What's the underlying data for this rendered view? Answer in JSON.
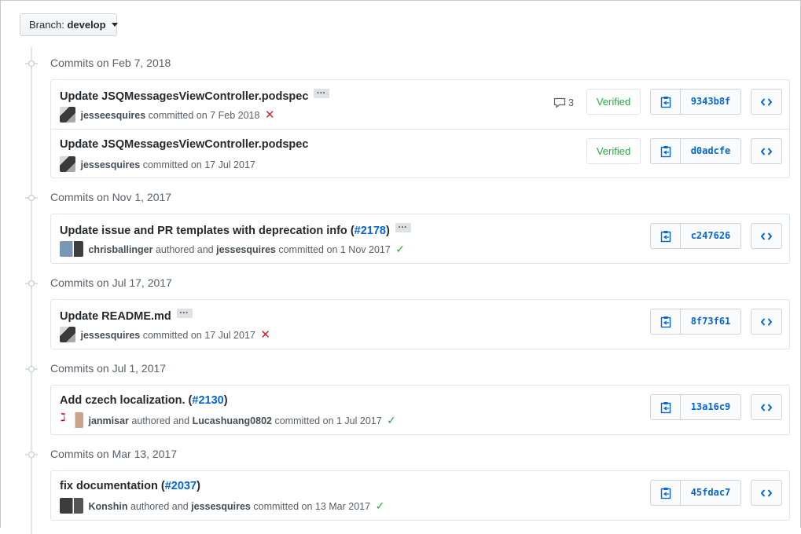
{
  "branch": {
    "label": "Branch:",
    "name": "develop"
  },
  "groups": [
    {
      "title": "Commits on Feb 7, 2018",
      "commits": [
        {
          "message": "Update JSQMessagesViewController.podspec",
          "has_ellipsis": true,
          "author": "jesseesquires",
          "meta_text": "committed on 7 Feb 2018",
          "status": "fail",
          "comments": "3",
          "verified": "Verified",
          "sha": "9343b8f"
        },
        {
          "message": "Update JSQMessagesViewController.podspec",
          "has_ellipsis": false,
          "author": "jessesquires",
          "meta_text": "committed on 17 Jul 2017",
          "status": "",
          "comments": "",
          "verified": "Verified",
          "sha": "d0adcfe"
        }
      ]
    },
    {
      "title": "Commits on Nov 1, 2017",
      "commits": [
        {
          "message": "Update issue and PR templates with deprecation info (",
          "pr": "#2178",
          "message_end": ")",
          "has_ellipsis": true,
          "author": "chrisballinger",
          "authored": "authored and",
          "committer": "jessesquires",
          "meta_text": "committed on 1 Nov 2017",
          "status": "ok",
          "sha": "c247626"
        }
      ]
    },
    {
      "title": "Commits on Jul 17, 2017",
      "commits": [
        {
          "message": "Update README.md",
          "has_ellipsis": true,
          "author": "jessesquires",
          "meta_text": "committed on 17 Jul 2017",
          "status": "fail",
          "sha": "8f73f61"
        }
      ]
    },
    {
      "title": "Commits on Jul 1, 2017",
      "commits": [
        {
          "message": "Add czech localization. (",
          "pr": "#2130",
          "message_end": ")",
          "has_ellipsis": false,
          "author": "janmisar",
          "authored": "authored and",
          "committer": "Lucashuang0802",
          "meta_text": "committed on 1 Jul 2017",
          "status": "ok",
          "sha": "13a16c9"
        }
      ]
    },
    {
      "title": "Commits on Mar 13, 2017",
      "commits": [
        {
          "message": "fix documentation (",
          "pr": "#2037",
          "message_end": ")",
          "has_ellipsis": false,
          "author": "Konshin",
          "authored": "authored and",
          "committer": "jessesquires",
          "meta_text": "committed on 13 Mar 2017",
          "status": "ok",
          "sha": "45fdac7"
        }
      ]
    }
  ],
  "colors": {
    "link": "#0366d6",
    "success": "#28a745",
    "fail": "#cb2431",
    "muted": "#586069"
  },
  "icons": {
    "copy": "clippy-icon",
    "browse": "code-icon",
    "comment": "comment-icon",
    "timeline": "git-commit-icon"
  }
}
